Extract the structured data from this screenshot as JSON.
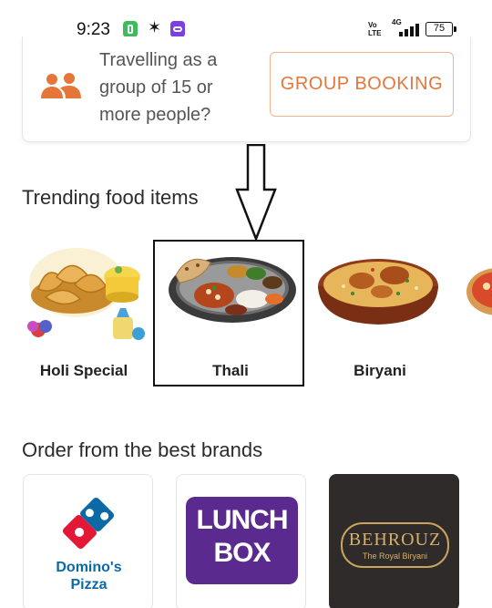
{
  "status_bar": {
    "time": "9:23",
    "volte": "Vo\nLTE",
    "network": "4G",
    "battery": "75"
  },
  "group_booking": {
    "icon": "group-people-icon",
    "text": "Travelling as a group of 15 or more people?",
    "button_label": "GROUP BOOKING",
    "accent_color": "#e5763a"
  },
  "trending": {
    "title": "Trending food items",
    "items": [
      {
        "label": "Holi Special",
        "icon": "gujiya-plate-image"
      },
      {
        "label": "Thali",
        "icon": "thali-plate-image"
      },
      {
        "label": "Biryani",
        "icon": "biryani-bowl-image"
      },
      {
        "label": "",
        "icon": "pizza-image"
      }
    ]
  },
  "brands": {
    "title": "Order from the best brands",
    "items": [
      {
        "name": "Domino's Pizza",
        "line1": "Domino's",
        "line2": "Pizza"
      },
      {
        "name": "Lunch Box",
        "line1": "LUNCH",
        "line2": "BOX"
      },
      {
        "name": "Behrouz",
        "line1": "BEHROUZ",
        "line2": "The Royal Biryani"
      }
    ]
  }
}
